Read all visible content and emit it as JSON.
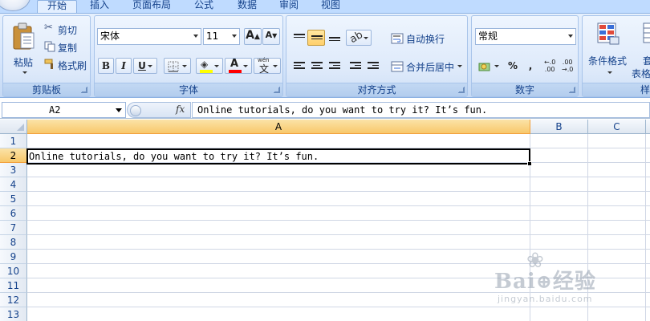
{
  "tabs": [
    "开始",
    "插入",
    "页面布局",
    "公式",
    "数据",
    "审阅",
    "视图"
  ],
  "active_tab": "开始",
  "clipboard": {
    "paste": "粘贴",
    "cut": "剪切",
    "copy": "复制",
    "format_painter": "格式刷",
    "group_label": "剪贴板"
  },
  "font": {
    "name": "宋体",
    "size": "11",
    "bold": "B",
    "italic": "I",
    "underline": "U",
    "font_color_glyph": "A",
    "phonetic": "文",
    "phonetic_top": "wén",
    "grow_glyph": "A",
    "shrink_glyph": "A",
    "group_label": "字体",
    "highlight_color": "#ffff00",
    "font_color": "#ff0000"
  },
  "alignment": {
    "wrap_text": "自动换行",
    "merge_center": "合并后居中",
    "group_label": "对齐方式"
  },
  "number": {
    "format": "常规",
    "percent": "%",
    "comma": ",",
    "increase_decimal": "+.0\n.00",
    "decrease_decimal": ".00\n→.0",
    "group_label": "数字"
  },
  "styles": {
    "conditional_formatting": "条件格式",
    "format_as_table_partial": "套",
    "format_as_table_partial2": "表格",
    "group_label_partial": "样"
  },
  "formula_bar": {
    "name_box": "A2",
    "fx": "fx",
    "content": "Online tutorials, do you want to try it? It’s fun."
  },
  "sheet": {
    "columns": [
      "A",
      "B",
      "C"
    ],
    "selected_column": "A",
    "rows": [
      "1",
      "2",
      "3",
      "4",
      "5",
      "6",
      "7",
      "8",
      "9",
      "10",
      "11",
      "12",
      "13"
    ],
    "selected_row": "2",
    "active_cell": "A2",
    "cell_A2": "Online tutorials, do you want to try it? It’s fun."
  },
  "watermark": {
    "brand": "Bai",
    "brand2": "经验",
    "url": "jingyan.baidu.com"
  },
  "colors": {
    "ribbon_bg": "#d5e5fb",
    "accent_border": "#8db2e3",
    "selection_header": "#f8c86a"
  }
}
